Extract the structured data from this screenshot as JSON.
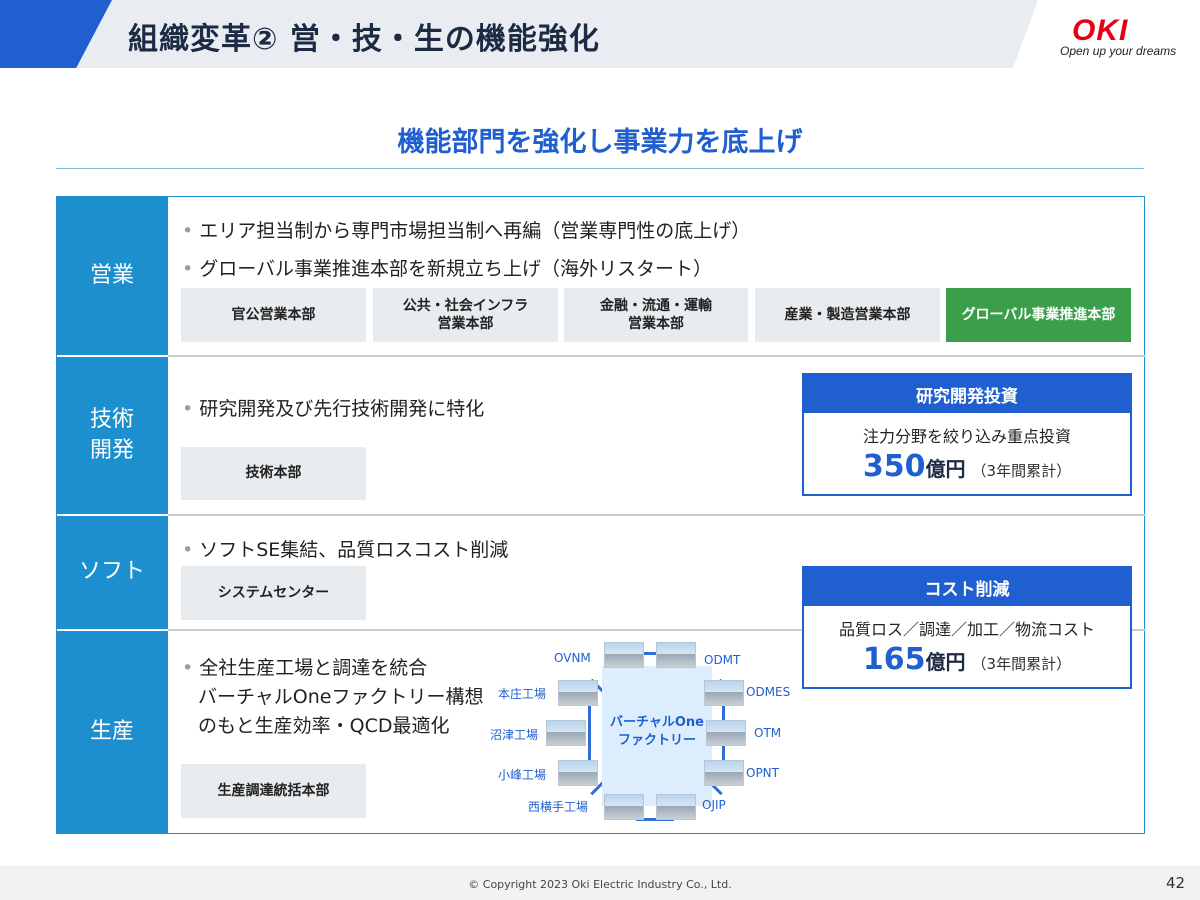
{
  "header": {
    "title": "組織変革② 営・技・生の機能強化"
  },
  "logo": {
    "name": "OKI",
    "tagline": "Open up your dreams"
  },
  "subtitle": "機能部門を強化し事業力を底上げ",
  "sales": {
    "label": "営業",
    "bullets": [
      "エリア担当制から専門市場担当制へ再編（営業専門性の底上げ）",
      "グローバル事業推進本部を新規立ち上げ（海外リスタート）"
    ],
    "depts": [
      "官公営業本部",
      "公共・社会インフラ\n営業本部",
      "金融・流通・運輸\n営業本部",
      "産業・製造営業本部",
      "グローバル事業推進本部"
    ]
  },
  "rnd": {
    "label": "技術\n開発",
    "bullet": "研究開発及び先行技術開発に特化",
    "dept": "技術本部",
    "box": {
      "title": "研究開発投資",
      "desc": "注力分野を絞り込み重点投資",
      "amount": "350",
      "unit": "億円",
      "note": "（3年間累計）"
    }
  },
  "soft": {
    "label": "ソフト",
    "bullet": "ソフトSE集結、品質ロスコスト削減",
    "dept": "システムセンター",
    "box": {
      "title": "コスト削減",
      "desc": "品質ロス／調達／加工／物流コスト",
      "amount": "165",
      "unit": "億円",
      "note": "（3年間累計）"
    }
  },
  "production": {
    "label": "生産",
    "bullet_lines": [
      "全社生産工場と調達を統合",
      "バーチャルOneファクトリー構想",
      "のもと生産効率・QCD最適化"
    ],
    "dept": "生産調達統括本部",
    "diagram": {
      "center": "バーチャルOne\nファクトリー",
      "sites": [
        "OVNM",
        "ODMT",
        "本庄工場",
        "ODMES",
        "沼津工場",
        "OTM",
        "小峰工場",
        "OPNT",
        "西横手工場",
        "OJIP"
      ]
    }
  },
  "footer": {
    "copyright": "© Copyright 2023 Oki Electric Industry Co., Ltd.",
    "page": "42"
  }
}
